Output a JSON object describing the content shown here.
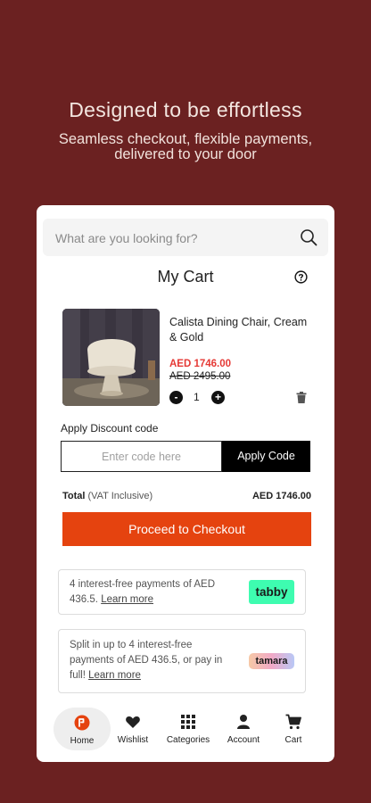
{
  "hero": {
    "title": "Designed to be effortless",
    "subtitle_line1": "Seamless checkout, flexible payments,",
    "subtitle_line2": "delivered to your door"
  },
  "search": {
    "placeholder": "What are you looking for?",
    "icon": "search-icon"
  },
  "cart": {
    "title": "My Cart",
    "help_icon": "question-circle-icon",
    "item": {
      "name": "Calista Dining Chair, Cream & Gold",
      "price_now": "AED 1746.00",
      "price_was": "AED 2495.00",
      "quantity": "1",
      "minus": "-",
      "plus": "+"
    },
    "discount": {
      "label": "Apply Discount code",
      "placeholder": "Enter code here",
      "button": "Apply Code"
    },
    "total": {
      "label": "Total",
      "note": "(VAT Inclusive)",
      "amount": "AED 1746.00"
    },
    "checkout_button": "Proceed to Checkout"
  },
  "payments": {
    "tabby": {
      "text": "4 interest-free payments of AED 436.5.",
      "link": "Learn more",
      "logo": "tabby"
    },
    "tamara": {
      "text": "Split in up to 4 interest-free payments of AED 436.5, or pay in full!",
      "link": "Learn more",
      "logo": "tamara"
    }
  },
  "nav": {
    "items": [
      {
        "label": "Home",
        "icon": "home-logo-icon"
      },
      {
        "label": "Wishlist",
        "icon": "heart-icon"
      },
      {
        "label": "Categories",
        "icon": "grid-icon"
      },
      {
        "label": "Account",
        "icon": "user-icon"
      },
      {
        "label": "Cart",
        "icon": "cart-icon"
      }
    ]
  },
  "colors": {
    "background": "#6b2121",
    "accent": "#e5430f",
    "price_sale": "#e53935",
    "tabby": "#3efcb0"
  }
}
